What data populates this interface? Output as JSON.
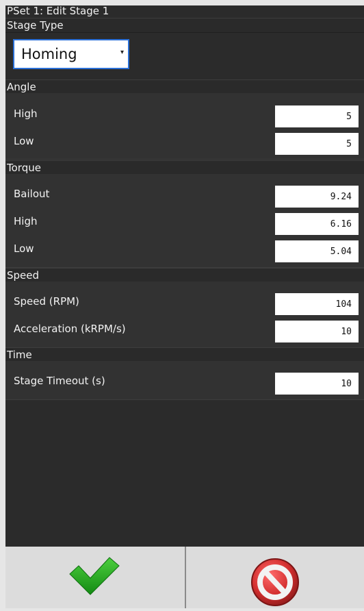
{
  "window": {
    "title": "PSet 1: Edit Stage 1"
  },
  "stage_type": {
    "header": "Stage Type",
    "selected": "Homing",
    "caret": "▾"
  },
  "angle": {
    "header": "Angle",
    "rows": [
      {
        "label": "High",
        "value": "5"
      },
      {
        "label": "Low",
        "value": "5"
      }
    ]
  },
  "torque": {
    "header": "Torque",
    "rows": [
      {
        "label": "Bailout",
        "value": "9.24"
      },
      {
        "label": "High",
        "value": "6.16"
      },
      {
        "label": "Low",
        "value": "5.04"
      }
    ]
  },
  "speed": {
    "header": "Speed",
    "rows": [
      {
        "label": "Speed (RPM)",
        "value": "104"
      },
      {
        "label": "Acceleration (kRPM/s)",
        "value": "10"
      }
    ]
  },
  "time": {
    "header": "Time",
    "rows": [
      {
        "label": "Stage Timeout (s)",
        "value": "10"
      }
    ]
  },
  "footer": {
    "ok_icon": "checkmark-icon",
    "cancel_icon": "cancel-icon",
    "colors": {
      "check": "#1e9e1e",
      "cancel": "#c62828"
    }
  }
}
